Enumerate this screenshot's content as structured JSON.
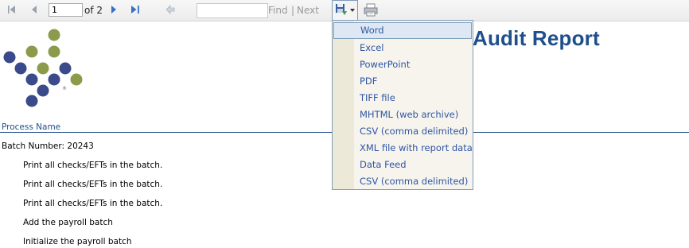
{
  "toolbar": {
    "page_value": "1",
    "of_label": "of 2",
    "find_label": "Find",
    "separator": "|",
    "next_label": "Next",
    "icons": [
      "first-page-icon",
      "previous-page-icon",
      "next-page-icon",
      "last-page-icon",
      "back-icon",
      "save-export-icon",
      "dropdown-arrow-icon",
      "print-icon"
    ]
  },
  "export_menu": {
    "items": [
      "Word",
      "Excel",
      "PowerPoint",
      "PDF",
      "TIFF file",
      "MHTML (web archive)",
      "CSV (comma delimited)",
      "XML file with report data",
      "Data Feed",
      "CSV (comma delimited)"
    ],
    "selected": "Word"
  },
  "report": {
    "title": "Audit Report",
    "column_header": "Process Name",
    "batch_label": "Batch Number: 20243",
    "steps": [
      "Print all checks/EFTs in the batch.",
      "Print all checks/EFTs in the batch.",
      "Print all checks/EFTs in the batch.",
      "Add the payroll batch",
      "Initialize the payroll batch"
    ],
    "logo_mark": "®"
  },
  "colors": {
    "title_blue": "#1f4e8c",
    "menu_link": "#2f56a6",
    "logo_navy": "#3b4a8a",
    "logo_olive": "#8c9a4c"
  }
}
